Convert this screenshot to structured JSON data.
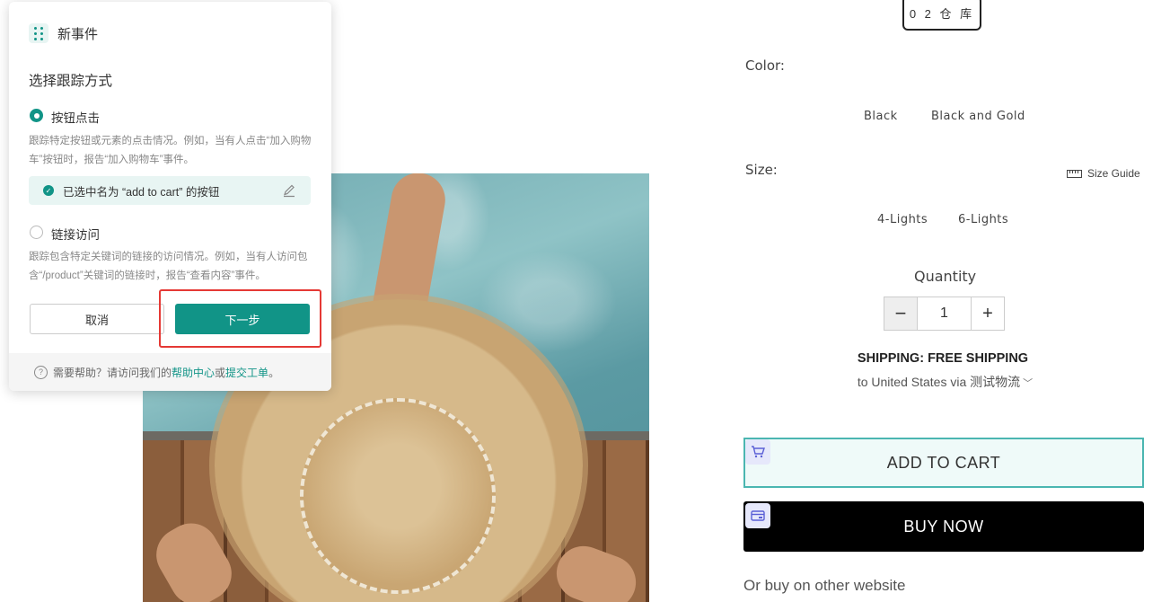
{
  "product": {
    "warehouse_label": "0 2 仓 库",
    "color_label": "Color:",
    "colors": [
      "Black",
      "Black and Gold"
    ],
    "size_label": "Size:",
    "size_guide": "Size Guide",
    "sizes": [
      "4-Lights",
      "6-Lights"
    ],
    "quantity_label": "Quantity",
    "quantity_value": "1",
    "minus": "−",
    "plus": "+",
    "shipping_title": "SHIPPING: FREE SHIPPING",
    "shipping_sub": "to United States via 测试物流",
    "add_to_cart": "ADD TO CART",
    "buy_now": "BUY NOW",
    "other_site": "Or buy on other website"
  },
  "popup": {
    "title": "新事件",
    "section_title": "选择跟踪方式",
    "option1": {
      "label": "按钮点击",
      "desc": "跟踪特定按钮或元素的点击情况。例如，当有人点击“加入购物车”按钮时，报告“加入购物车”事件。",
      "selected_text": "已选中名为 “add to cart” 的按钮",
      "checked": true
    },
    "option2": {
      "label": "链接访问",
      "desc": "跟踪包含特定关键词的链接的访问情况。例如，当有人访问包含“/product”关键词的链接时，报告“查看内容”事件。",
      "checked": false
    },
    "cancel": "取消",
    "next": "下一步",
    "footer": {
      "prefix": "需要帮助？请访问我们的",
      "link1": "帮助中心",
      "or": "或",
      "link2": "提交工单",
      "suffix": "。"
    }
  },
  "colors": {
    "accent": "#119487",
    "cart_border": "#4bb6b1",
    "highlight": "#e53935"
  },
  "icons": [
    "drag-handle-icon",
    "edit-pencil-icon",
    "check-circle-icon",
    "help-circle-icon",
    "cart-icon",
    "card-icon",
    "ruler-icon",
    "chevron-down-icon"
  ]
}
